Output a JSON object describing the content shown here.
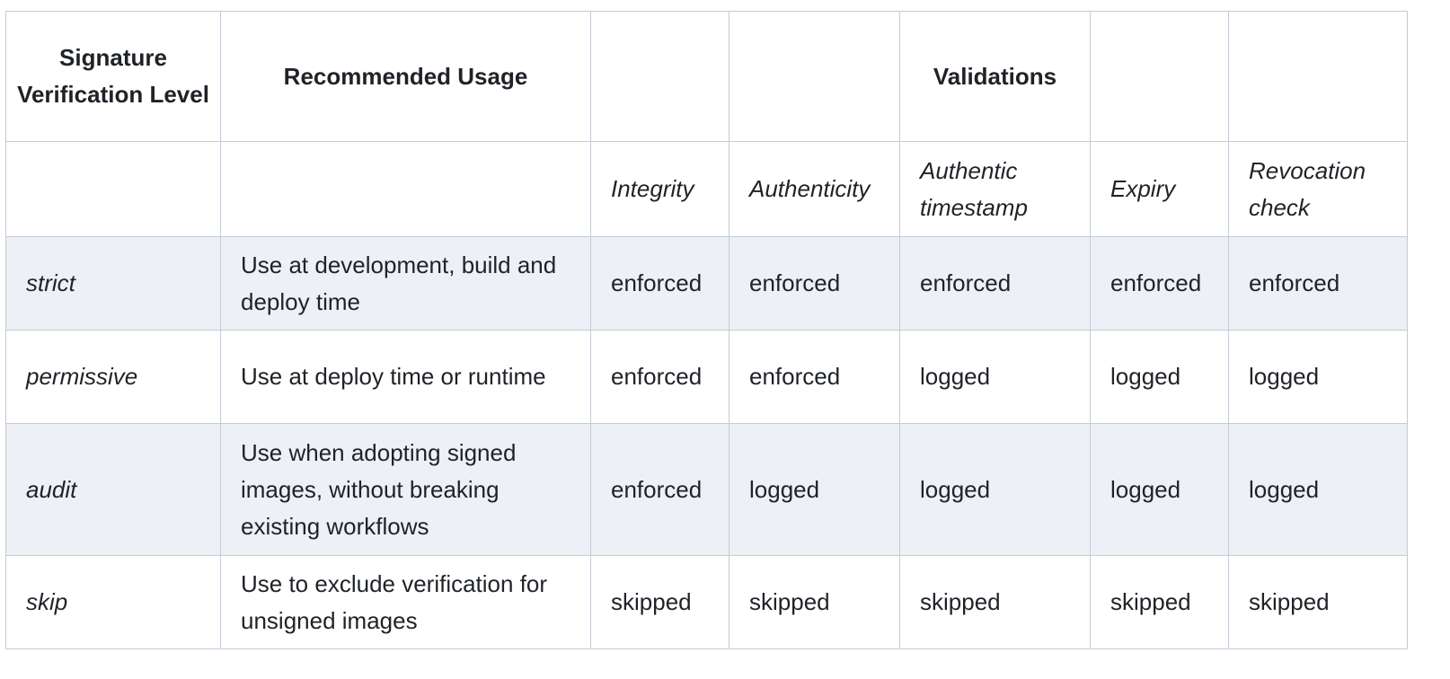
{
  "table": {
    "header": {
      "level": "Signature Verification Level",
      "usage": "Recommended Usage",
      "validations": "Validations"
    },
    "validation_columns": [
      "Integrity",
      "Authenticity",
      "Authentic timestamp",
      "Expiry",
      "Revocation check"
    ],
    "rows": [
      {
        "level": "strict",
        "usage": "Use at development, build and deploy time",
        "values": [
          "enforced",
          "enforced",
          "enforced",
          "enforced",
          "enforced"
        ]
      },
      {
        "level": "permissive",
        "usage": "Use at deploy time or runtime",
        "values": [
          "enforced",
          "enforced",
          "logged",
          "logged",
          "logged"
        ]
      },
      {
        "level": "audit",
        "usage": "Use when adopting signed images, without breaking existing workflows",
        "values": [
          "enforced",
          "logged",
          "logged",
          "logged",
          "logged"
        ]
      },
      {
        "level": "skip",
        "usage": "Use to exclude verification for unsigned images",
        "values": [
          "skipped",
          "skipped",
          "skipped",
          "skipped",
          "skipped"
        ]
      }
    ],
    "row_shading": "#edf1f6",
    "border_color": "#c4ccd6"
  }
}
